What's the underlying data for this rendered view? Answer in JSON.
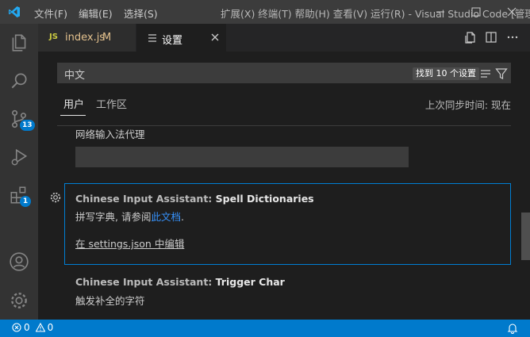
{
  "menu": {
    "file": "文件(F)",
    "edit": "编辑(E)",
    "selection": "选择(S)",
    "overlay_title": "扩展(X) 终端(T) 帮助(H) 查看(V) 运行(R) - Visual Studio Code [管理员]"
  },
  "tabs": [
    {
      "icon": "JS",
      "label": "index.js",
      "modified": "M"
    },
    {
      "icon": "settings-list-icon",
      "label": "设置"
    }
  ],
  "search": {
    "value": "中文",
    "result_count": "找到 10 个设置"
  },
  "scopes": {
    "user": "用户",
    "workspace": "工作区",
    "sync_status": "上次同步时间: 现在"
  },
  "settings": [
    {
      "description": "网络输入法代理"
    },
    {
      "category": "Chinese Input Assistant: ",
      "name": "Spell Dictionaries",
      "description_prefix": "拼写字典, 请参阅",
      "description_link": "此文档",
      "description_suffix": ".",
      "edit_link": "在 settings.json 中编辑"
    },
    {
      "category": "Chinese Input Assistant: ",
      "name": "Trigger Char",
      "description": "触发补全的字符"
    }
  ],
  "activity_badges": {
    "source_control": "13",
    "extensions": "1"
  },
  "status": {
    "errors": "0",
    "warnings": "0"
  },
  "colors": {
    "accent": "#007acc",
    "focus_border": "#007fd4",
    "link": "#3794ff"
  }
}
